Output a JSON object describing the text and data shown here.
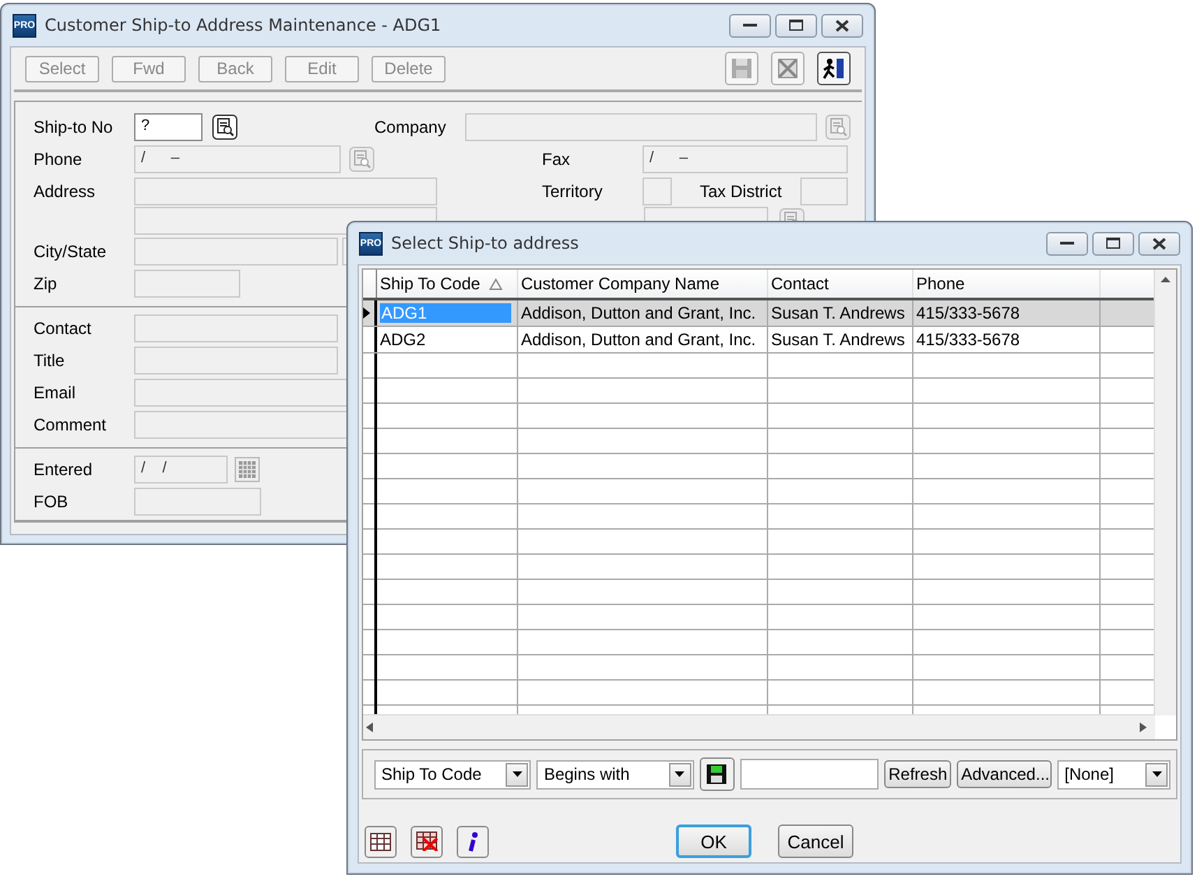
{
  "main_window": {
    "badge": "PRO",
    "title": "Customer Ship-to Address Maintenance - ADG1",
    "toolbar_buttons": [
      {
        "label": "Select",
        "disabled": true
      },
      {
        "label": "Fwd",
        "disabled": true
      },
      {
        "label": "Back",
        "disabled": true
      },
      {
        "label": "Edit",
        "disabled": true
      },
      {
        "label": "Delete",
        "disabled": true
      }
    ],
    "form": {
      "ship_to_no": {
        "label": "Ship-to No",
        "value": "?",
        "disabled": false
      },
      "company": {
        "label": "Company",
        "disabled": true
      },
      "phone": {
        "label": "Phone",
        "value": "/      –",
        "disabled": true
      },
      "fax": {
        "label": "Fax",
        "value": "/      –",
        "disabled": true
      },
      "address": {
        "label": "Address",
        "disabled": true
      },
      "address_2": {
        "disabled": true
      },
      "territory": {
        "label": "Territory",
        "disabled": true
      },
      "tax_district": {
        "label": "Tax District",
        "disabled": true
      },
      "tax_table_id": {
        "disabled": true
      },
      "city_state": {
        "label": "City/State",
        "disabled": true
      },
      "zip": {
        "label": "Zip",
        "disabled": true
      },
      "contact": {
        "label": "Contact",
        "disabled": true
      },
      "title": {
        "label": "Title",
        "disabled": true
      },
      "email": {
        "label": "Email",
        "disabled": true
      },
      "comment": {
        "label": "Comment",
        "disabled": true
      },
      "entered": {
        "label": "Entered",
        "value": "/    /",
        "disabled": true
      },
      "fob": {
        "label": "FOB",
        "disabled": true
      }
    }
  },
  "dialog": {
    "badge": "PRO",
    "title": "Select Ship-to address",
    "columns": [
      "Ship To Code",
      "Customer Company Name",
      "Contact",
      "Phone"
    ],
    "rows": [
      {
        "cells": [
          "ADG1",
          "Addison, Dutton and Grant, Inc.",
          "Susan T. Andrews",
          "415/333-5678"
        ],
        "selected": true
      },
      {
        "cells": [
          "ADG2",
          "Addison, Dutton and Grant, Inc.",
          "Susan T. Andrews",
          "415/333-5678"
        ],
        "selected": false
      }
    ],
    "filter": {
      "column": "Ship To Code",
      "operator": "Begins with",
      "refresh": "Refresh",
      "advanced": "Advanced...",
      "preset": "[None]"
    },
    "buttons": [
      {
        "label": "OK",
        "default": true
      },
      {
        "label": "Cancel",
        "default": false
      }
    ]
  }
}
